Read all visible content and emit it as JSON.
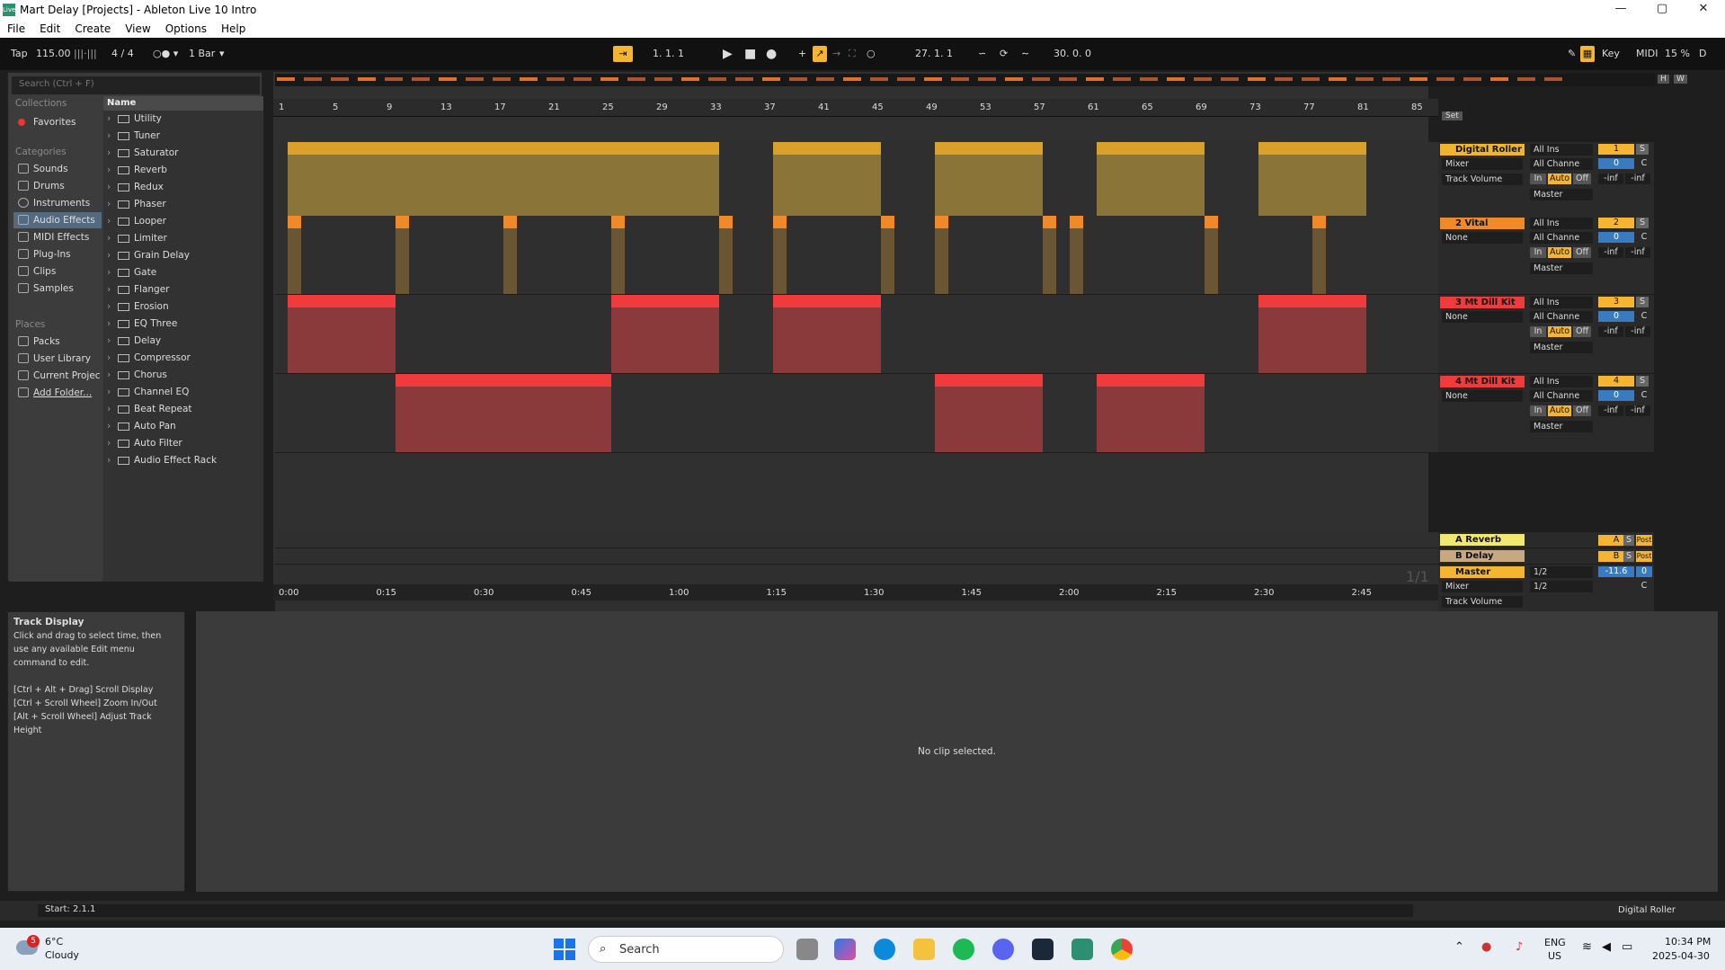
{
  "window": {
    "title": "Mart Delay  [Projects] - Ableton Live 10 Intro",
    "logo": "Live",
    "minimize": "—",
    "maximize": "▢",
    "close": "✕"
  },
  "menu": [
    "File",
    "Edit",
    "Create",
    "View",
    "Options",
    "Help"
  ],
  "transport": {
    "tap": "Tap",
    "tempo": "115.00",
    "signature": "4 / 4",
    "quantize": "1 Bar",
    "position": "1.   1.   1",
    "loop_start": "27.   1.   1",
    "loop_length": "30.   0.   0",
    "key": "Key",
    "midi": "MIDI",
    "cpu": "15 %",
    "d": "D"
  },
  "browser": {
    "search_placeholder": "Search (Ctrl + F)",
    "collections_label": "Collections",
    "favorites": "Favorites",
    "categories_label": "Categories",
    "categories": [
      "Sounds",
      "Drums",
      "Instruments",
      "Audio Effects",
      "MIDI Effects",
      "Plug-Ins",
      "Clips",
      "Samples"
    ],
    "selected_category": "Audio Effects",
    "places_label": "Places",
    "places": [
      "Packs",
      "User Library",
      "Current Projec",
      "Add Folder..."
    ],
    "name_header": "Name",
    "items": [
      "Utility",
      "Tuner",
      "Saturator",
      "Reverb",
      "Redux",
      "Phaser",
      "Looper",
      "Limiter",
      "Grain Delay",
      "Gate",
      "Flanger",
      "Erosion",
      "EQ Three",
      "Delay",
      "Compressor",
      "Chorus",
      "Channel EQ",
      "Beat Repeat",
      "Auto Pan",
      "Auto Filter",
      "Audio Effect Rack"
    ]
  },
  "ruler": {
    "bars": [
      "1",
      "5",
      "9",
      "13",
      "17",
      "21",
      "25",
      "29",
      "33",
      "37",
      "41",
      "45",
      "49",
      "53",
      "57",
      "61",
      "65",
      "69",
      "73",
      "77",
      "81",
      "85"
    ],
    "set_label": "Set",
    "h": "H",
    "w": "W"
  },
  "time_ruler": [
    "0:00",
    "0:15",
    "0:30",
    "0:45",
    "1:00",
    "1:15",
    "1:30",
    "1:45",
    "2:00",
    "2:15",
    "2:30",
    "2:45"
  ],
  "page_indicator": "1/1",
  "tracks": [
    {
      "name": "Digital Roller",
      "color": "#f0b42e",
      "input": "All Ins",
      "channel": "Mixer",
      "channel2": "All Channe",
      "device": "Track Volume",
      "num": "1",
      "vol": "0",
      "pan": "C",
      "monitor": [
        "In",
        "Auto",
        "Off"
      ],
      "out": "Master",
      "peak": [
        "-inf",
        "-inf"
      ]
    },
    {
      "name": "2 Vital",
      "color": "#f08a28",
      "input": "All Ins",
      "channel": "None",
      "channel2": "All Channe",
      "num": "2",
      "vol": "0",
      "pan": "C",
      "monitor": [
        "In",
        "Auto",
        "Off"
      ],
      "out": "Master",
      "peak": [
        "-inf",
        "-inf"
      ]
    },
    {
      "name": "3 Mt Dill Kit",
      "color": "#ef3b3b",
      "input": "All Ins",
      "channel": "None",
      "channel2": "All Channe",
      "num": "3",
      "vol": "0",
      "pan": "C",
      "monitor": [
        "In",
        "Auto",
        "Off"
      ],
      "out": "Master",
      "peak": [
        "-inf",
        "-inf"
      ]
    },
    {
      "name": "4 Mt Dill Kit",
      "color": "#ef3b3b",
      "input": "All Ins",
      "channel": "None",
      "channel2": "All Channe",
      "num": "4",
      "vol": "0",
      "pan": "C",
      "monitor": [
        "In",
        "Auto",
        "Off"
      ],
      "out": "Master",
      "peak": [
        "-inf",
        "-inf"
      ]
    }
  ],
  "returns": [
    {
      "name": "A Reverb",
      "letter": "A",
      "post": "Post",
      "s": "S"
    },
    {
      "name": "B Delay",
      "letter": "B",
      "post": "Post",
      "s": "S"
    }
  ],
  "master": {
    "name": "Master",
    "ratio1": "1/2",
    "ratio2": "1/2",
    "vol": "-11.6",
    "pan_val": "0",
    "pan": "C",
    "channel": "Mixer",
    "device": "Track Volume"
  },
  "info": {
    "title": "Track Display",
    "body": "Click and drag to select time, then use any available Edit menu command to edit.",
    "hints": [
      "[Ctrl + Alt + Drag] Scroll Display",
      "[Ctrl + Scroll Wheel] Zoom In/Out",
      "[Alt + Scroll Wheel] Adjust Track Height"
    ]
  },
  "clipview": {
    "empty": "No clip selected."
  },
  "status": {
    "text": "Start: 2.1.1",
    "track": "Digital Roller"
  },
  "taskbar": {
    "temp": "6°C",
    "weather": "Cloudy",
    "badge": "5",
    "search": "Search",
    "lang1": "ENG",
    "lang2": "US",
    "time": "10:34 PM",
    "date": "2025-04-30"
  }
}
